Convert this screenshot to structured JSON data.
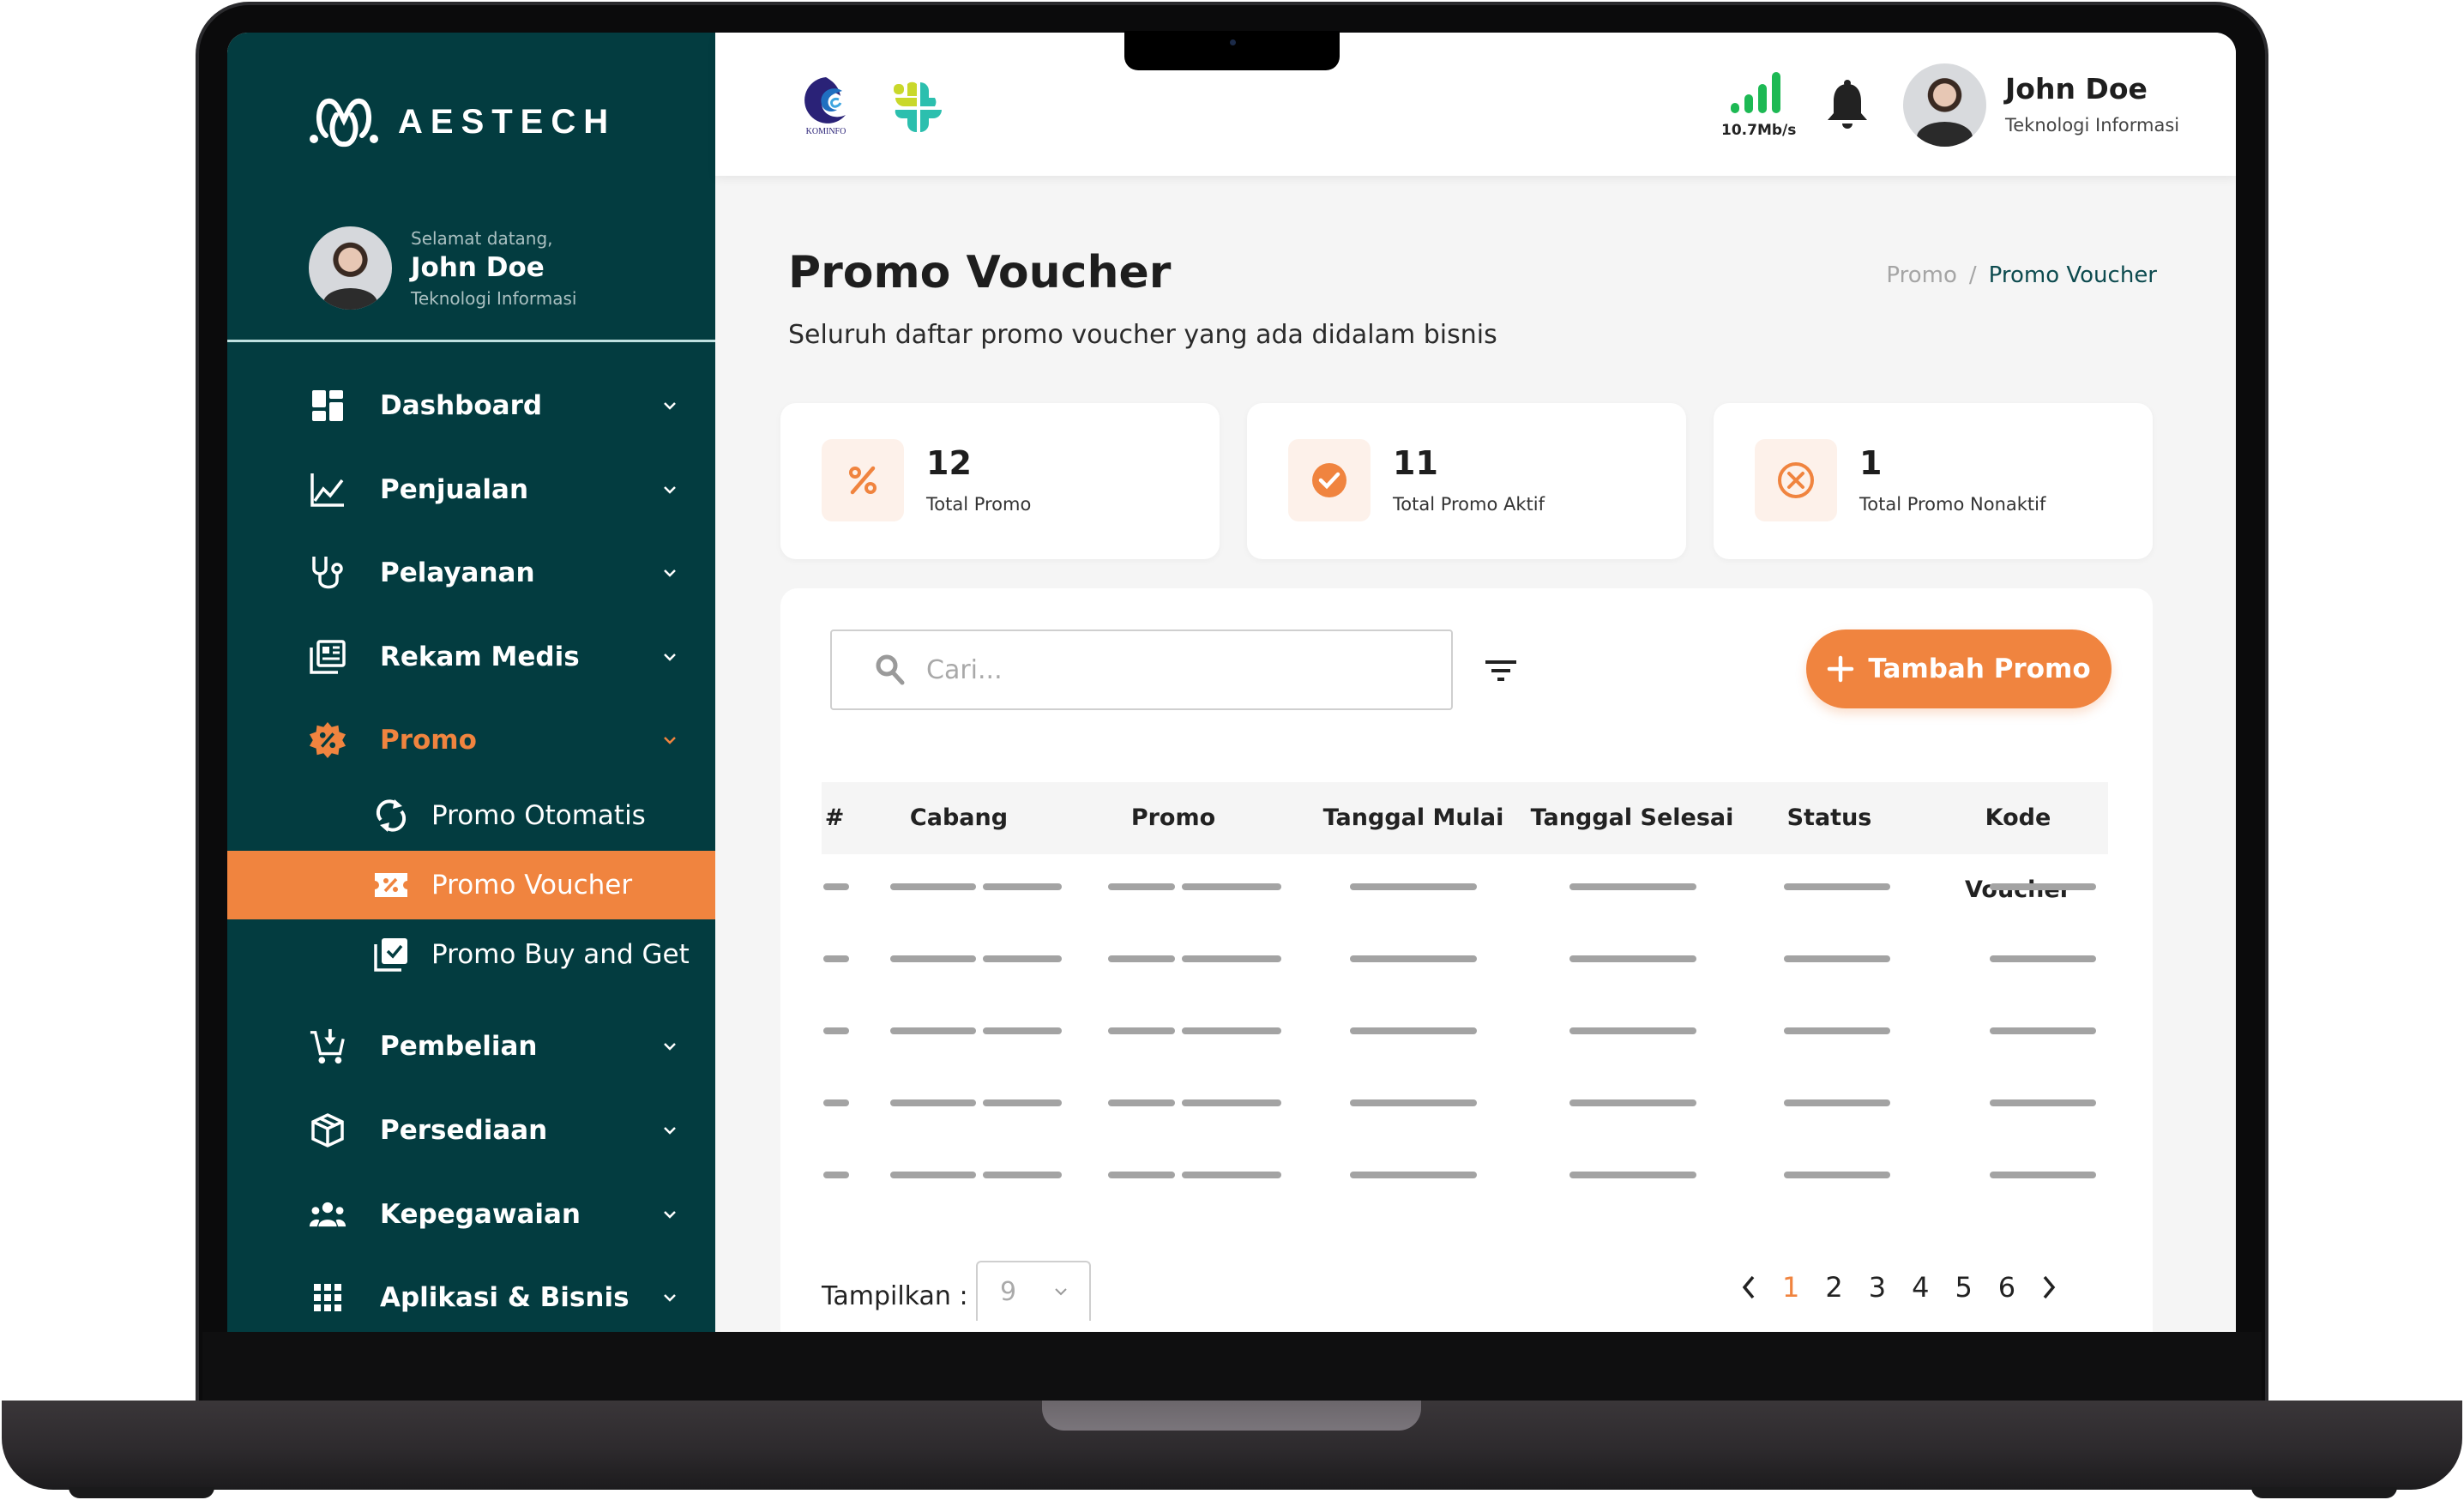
{
  "brand": {
    "name": "AESTECH"
  },
  "sidebar_profile": {
    "greeting": "Selamat datang,",
    "name": "John Doe",
    "role": "Teknologi Informasi"
  },
  "menu": [
    {
      "label": "Dashboard",
      "icon": "dashboard-icon"
    },
    {
      "label": "Penjualan",
      "icon": "chart-line-icon"
    },
    {
      "label": "Pelayanan",
      "icon": "stethoscope-icon"
    },
    {
      "label": "Rekam Medis",
      "icon": "newspaper-icon"
    },
    {
      "label": "Promo",
      "icon": "discount-badge-icon",
      "open": true,
      "children": [
        {
          "label": "Promo Otomatis",
          "icon": "sync-icon"
        },
        {
          "label": "Promo Voucher",
          "icon": "voucher-icon",
          "active": true
        },
        {
          "label": "Promo Buy and Get",
          "icon": "library-check-icon"
        }
      ]
    },
    {
      "label": "Pembelian",
      "icon": "cart-download-icon"
    },
    {
      "label": "Persediaan",
      "icon": "box-icon"
    },
    {
      "label": "Kepegawaian",
      "icon": "users-icon"
    },
    {
      "label": "Aplikasi & Bisnis",
      "icon": "apps-grid-icon"
    }
  ],
  "topbar": {
    "logo1_text": "KOMINFO",
    "network_speed": "10.7Mb/s",
    "user_name": "John Doe",
    "user_role": "Teknologi Informasi"
  },
  "page": {
    "title": "Promo Voucher",
    "subtitle": "Seluruh daftar promo voucher yang ada didalam bisnis",
    "breadcrumb": [
      "Promo",
      "Promo Voucher"
    ],
    "breadcrumb_sep": "/"
  },
  "stats": [
    {
      "value": "12",
      "label": "Total Promo",
      "icon": "percent-icon"
    },
    {
      "value": "11",
      "label": "Total Promo Aktif",
      "icon": "check-circle-icon"
    },
    {
      "value": "1",
      "label": "Total Promo Nonaktif",
      "icon": "x-circle-icon"
    }
  ],
  "toolbar": {
    "search_placeholder": "Cari...",
    "search_value": "",
    "add_label": "Tambah Promo"
  },
  "table": {
    "columns": [
      "#",
      "Cabang",
      "Promo",
      "Tanggal Mulai",
      "Tanggal Selesai",
      "Status",
      "Kode Voucher"
    ],
    "loading_rows": 5
  },
  "footer": {
    "show_label": "Tampilkan :",
    "page_size": "9",
    "pages": [
      "1",
      "2",
      "3",
      "4",
      "5",
      "6"
    ],
    "current_page": "1"
  },
  "colors": {
    "sidebar_bg": "#033c40",
    "accent": "#f0843f",
    "accent_soft": "#fdf1ea",
    "network_green": "#1db954",
    "breadcrumb_active": "#0d4b4f"
  }
}
